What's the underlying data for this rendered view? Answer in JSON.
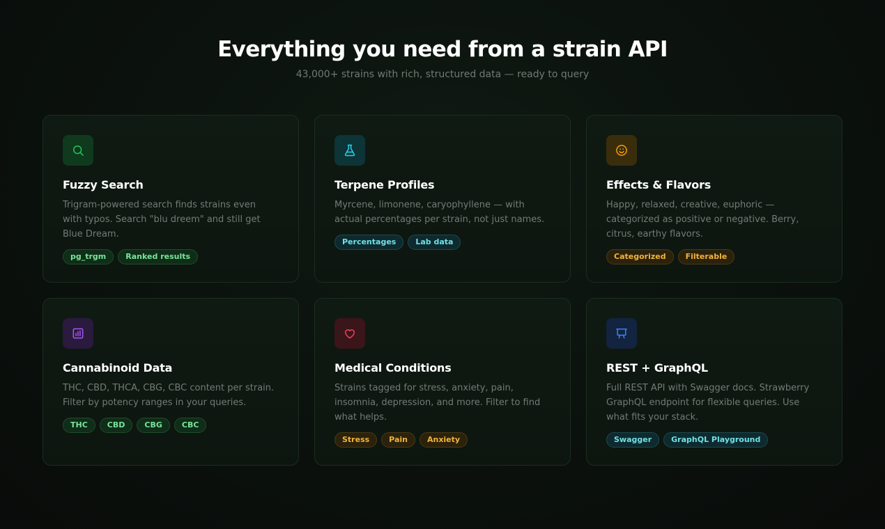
{
  "header": {
    "title": "Everything you need from a strain API",
    "subtitle": "43,000+ strains with rich, structured data — ready to query"
  },
  "cards": [
    {
      "title": "Fuzzy Search",
      "description": "Trigram-powered search finds strains even with typos. Search \"blu dreem\" and still get Blue Dream.",
      "icon": "search-icon",
      "accent": "#22c55e",
      "tags": [
        "pg_trgm",
        "Ranked results"
      ]
    },
    {
      "title": "Terpene Profiles",
      "description": "Myrcene, limonene, caryophyllene — with actual percentages per strain, not just names.",
      "icon": "flask-icon",
      "accent": "#22d3ee",
      "tags": [
        "Percentages",
        "Lab data"
      ]
    },
    {
      "title": "Effects & Flavors",
      "description": "Happy, relaxed, creative, euphoric — categorized as positive or negative. Berry, citrus, earthy flavors.",
      "icon": "smile-icon",
      "accent": "#f59e0b",
      "tags": [
        "Categorized",
        "Filterable"
      ]
    },
    {
      "title": "Cannabinoid Data",
      "description": "THC, CBD, THCA, CBG, CBC content per strain. Filter by potency ranges in your queries.",
      "icon": "bar-chart-icon",
      "accent": "#a855f7",
      "tags": [
        "THC",
        "CBD",
        "CBG",
        "CBC"
      ]
    },
    {
      "title": "Medical Conditions",
      "description": "Strains tagged for stress, anxiety, pain, insomnia, depression, and more. Filter to find what helps.",
      "icon": "heart-icon",
      "accent": "#f43f5e",
      "tags": [
        "Stress",
        "Pain",
        "Anxiety"
      ]
    },
    {
      "title": "REST + GraphQL",
      "description": "Full REST API with Swagger docs. Strawberry GraphQL endpoint for flexible queries. Use what fits your stack.",
      "icon": "presentation-icon",
      "accent": "#3b82f6",
      "tags": [
        "Swagger",
        "GraphQL Playground"
      ]
    }
  ]
}
